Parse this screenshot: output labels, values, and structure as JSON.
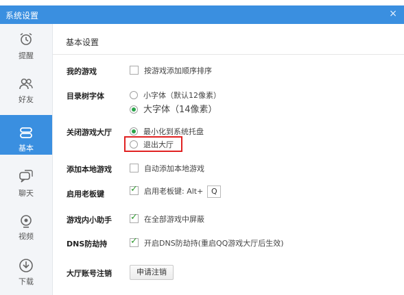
{
  "window": {
    "title": "系统设置",
    "close_glyph": "×"
  },
  "sidebar": {
    "items": [
      {
        "label": "提醒",
        "icon": "alarm-clock-icon"
      },
      {
        "label": "好友",
        "icon": "friends-icon"
      },
      {
        "label": "基本",
        "icon": "basic-settings-icon",
        "active": true
      },
      {
        "label": "聊天",
        "icon": "chat-bubble-icon"
      },
      {
        "label": "视频",
        "icon": "camera-icon"
      },
      {
        "label": "下载",
        "icon": "download-icon"
      }
    ]
  },
  "main": {
    "section_title": "基本设置",
    "rows": {
      "my_games": {
        "label": "我的游戏",
        "option": "按游戏添加顺序排序",
        "checked": false
      },
      "tree_font": {
        "label": "目录树字体",
        "options": [
          "小字体（默认12像素）",
          "大字体（14像素）"
        ],
        "selected": 1
      },
      "close_lobby": {
        "label": "关闭游戏大厅",
        "options": [
          "最小化到系统托盘",
          "退出大厅"
        ],
        "selected": 0
      },
      "add_local": {
        "label": "添加本地游戏",
        "option": "自动添加本地游戏",
        "checked": false
      },
      "boss_key": {
        "label": "启用老板键",
        "option": "启用老板键: Alt+",
        "checked": true,
        "key_value": "Q"
      },
      "in_game_helper": {
        "label": "游戏内小助手",
        "option": "在全部游戏中屏蔽",
        "checked": true
      },
      "dns": {
        "label": "DNS防劫持",
        "option": "开启DNS防劫持(重启QQ游戏大厅后生效)",
        "checked": true
      },
      "account_cancel": {
        "label": "大厅账号注销",
        "button": "申请注销"
      }
    }
  },
  "colors": {
    "accent": "#3a8fe0",
    "highlight_border": "#e02020",
    "check_green": "#2f9a2f"
  }
}
